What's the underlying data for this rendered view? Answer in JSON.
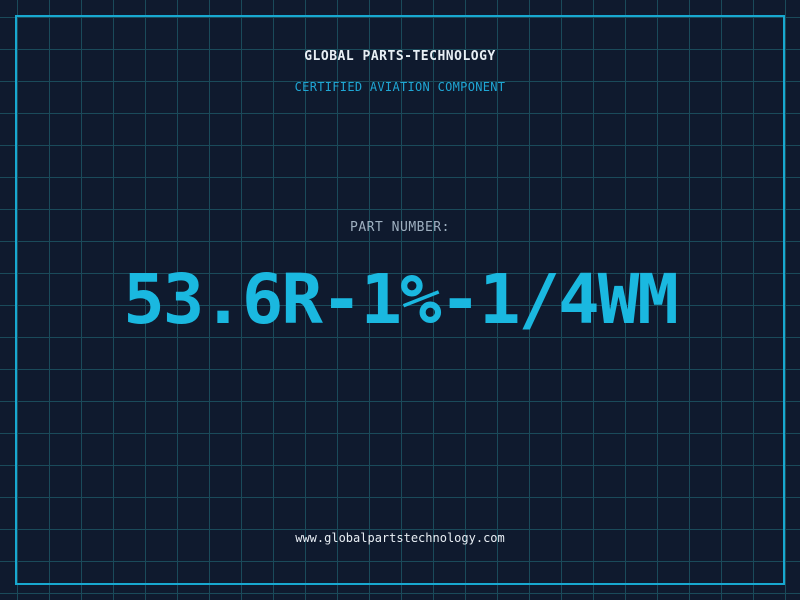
{
  "header": {
    "company_name": "GLOBAL PARTS-TECHNOLOGY",
    "tagline": "CERTIFIED AVIATION COMPONENT"
  },
  "part": {
    "label": "PART NUMBER:",
    "number": "53.6R-1%-1/4WM"
  },
  "footer": {
    "website": "www.globalpartstechnology.com"
  },
  "colors": {
    "background": "#0f1a2e",
    "grid": "#1a4a5a",
    "accent": "#1ab8e0",
    "text": "#e8eef4"
  }
}
